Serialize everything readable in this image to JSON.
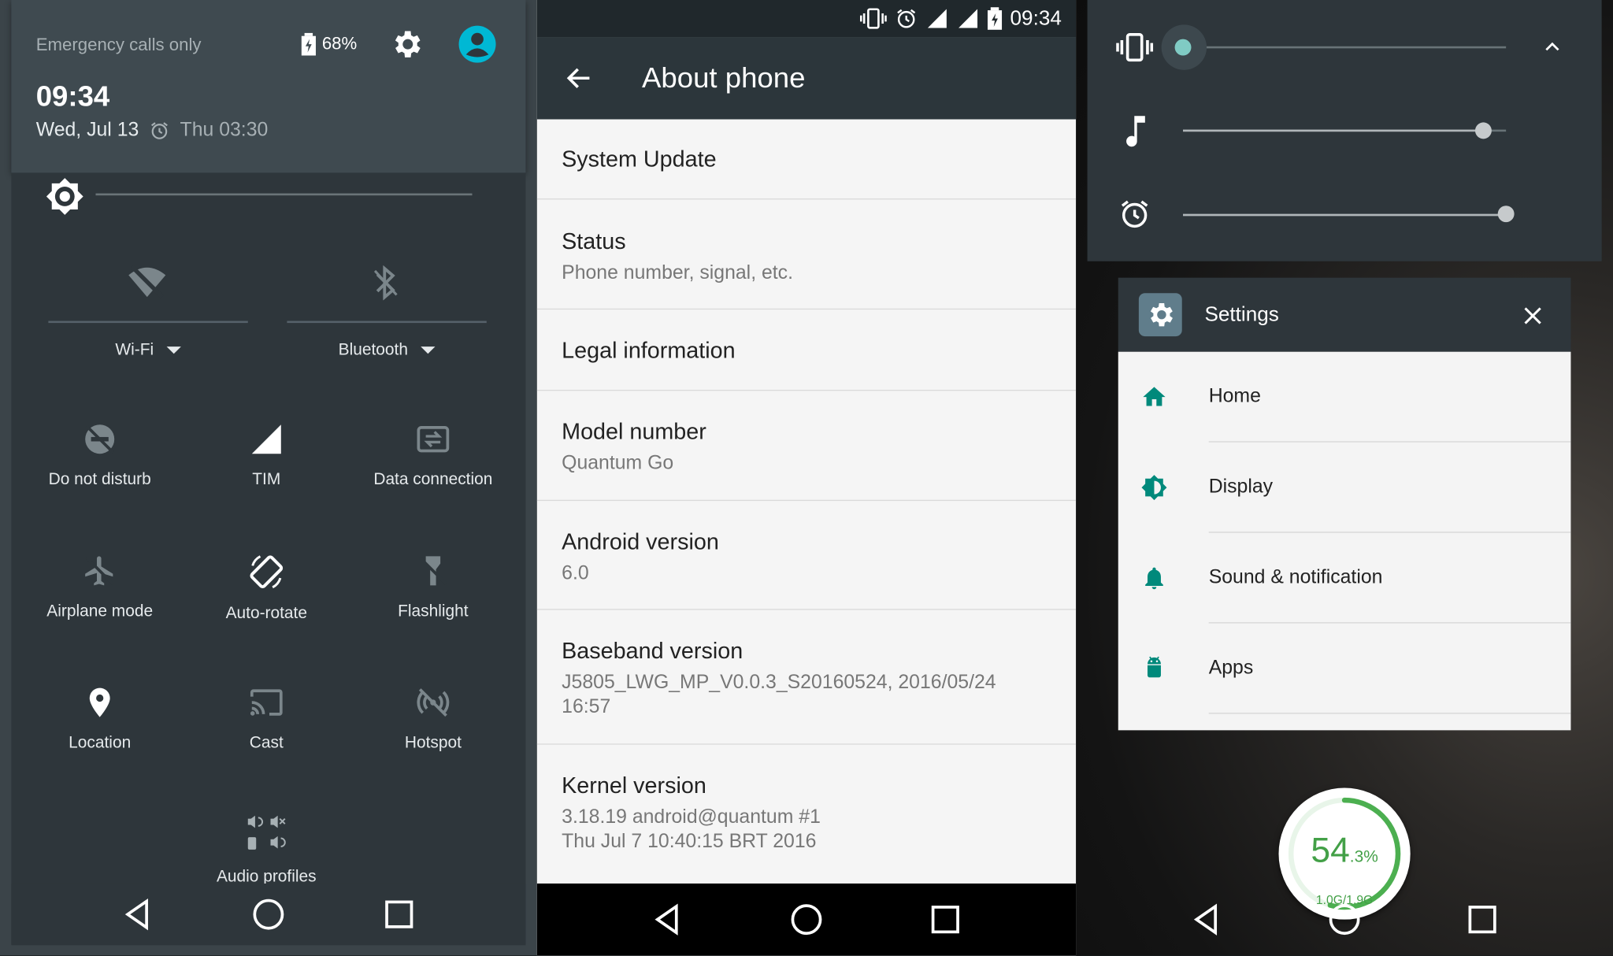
{
  "quick_settings": {
    "carrier": "Emergency calls only",
    "battery": "68%",
    "time": "09:34",
    "date": "Wed, Jul 13",
    "alarm": "Thu 03:30",
    "tiles": {
      "wifi": "Wi-Fi",
      "bluetooth": "Bluetooth",
      "dnd": "Do not disturb",
      "carrier_tile": "TIM",
      "data": "Data connection",
      "airplane": "Airplane mode",
      "autorotate": "Auto-rotate",
      "flashlight": "Flashlight",
      "location": "Location",
      "cast": "Cast",
      "hotspot": "Hotspot",
      "audio": "Audio profiles"
    },
    "brightness_level": 0.05
  },
  "about_phone": {
    "status_time": "09:34",
    "title": "About phone",
    "items": [
      {
        "title": "System Update",
        "sub": ""
      },
      {
        "title": "Status",
        "sub": "Phone number, signal, etc."
      },
      {
        "title": "Legal information",
        "sub": ""
      },
      {
        "title": "Model number",
        "sub": "Quantum Go"
      },
      {
        "title": "Android version",
        "sub": "6.0"
      },
      {
        "title": "Baseband version",
        "sub": "J5805_LWG_MP_V0.0.3_S20160524, 2016/05/24 16:57"
      },
      {
        "title": "Kernel version",
        "sub": "3.18.19 android@quantum #1 Thu Jul 7 10:40:15 BRT 2016"
      }
    ]
  },
  "volume": {
    "ring_level": 0.0,
    "media_level": 0.93,
    "alarm_level": 1.0
  },
  "recents": {
    "app_title": "Settings",
    "items": [
      "Home",
      "Display",
      "Sound & notification",
      "Apps"
    ]
  },
  "memory": {
    "percent_main": "54",
    "percent_decimal": ".3%",
    "usage": "1.0G/1.9G",
    "level": 0.543
  },
  "colors": {
    "accent": "#00a5b5",
    "teal": "#009688",
    "green": "#4caf50"
  }
}
